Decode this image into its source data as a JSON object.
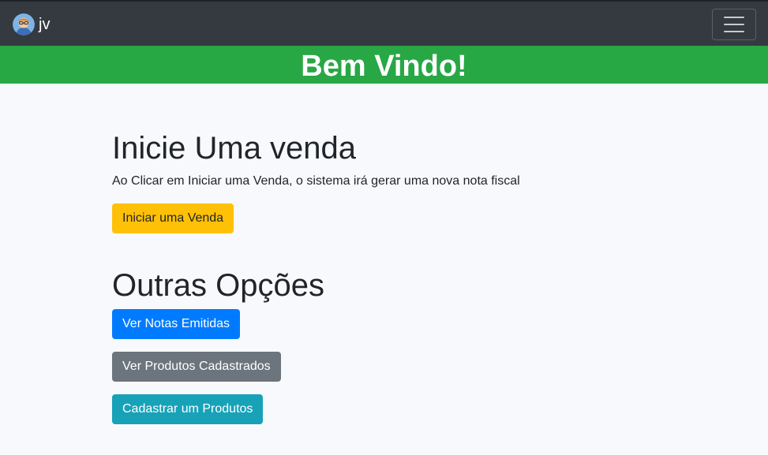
{
  "navbar": {
    "brand_text": "jv",
    "avatar_icon": "user-avatar-icon",
    "toggler_icon": "hamburger-menu-icon",
    "background": "#343a40"
  },
  "banner": {
    "title": "Bem Vindo!",
    "background": "#28a745"
  },
  "sale": {
    "heading": "Inicie Uma venda",
    "description": "Ao Clicar em Iniciar uma Venda, o sistema irá gerar uma nova nota fiscal",
    "button_label": "Iniciar uma Venda",
    "button_color": "#ffc107"
  },
  "options": {
    "heading": "Outras Opções",
    "buttons": [
      {
        "label": "Ver Notas Emitidas",
        "color": "#007bff"
      },
      {
        "label": "Ver Produtos Cadastrados",
        "color": "#6c757d"
      },
      {
        "label": "Cadastrar um Produtos",
        "color": "#17a2b8"
      }
    ]
  }
}
